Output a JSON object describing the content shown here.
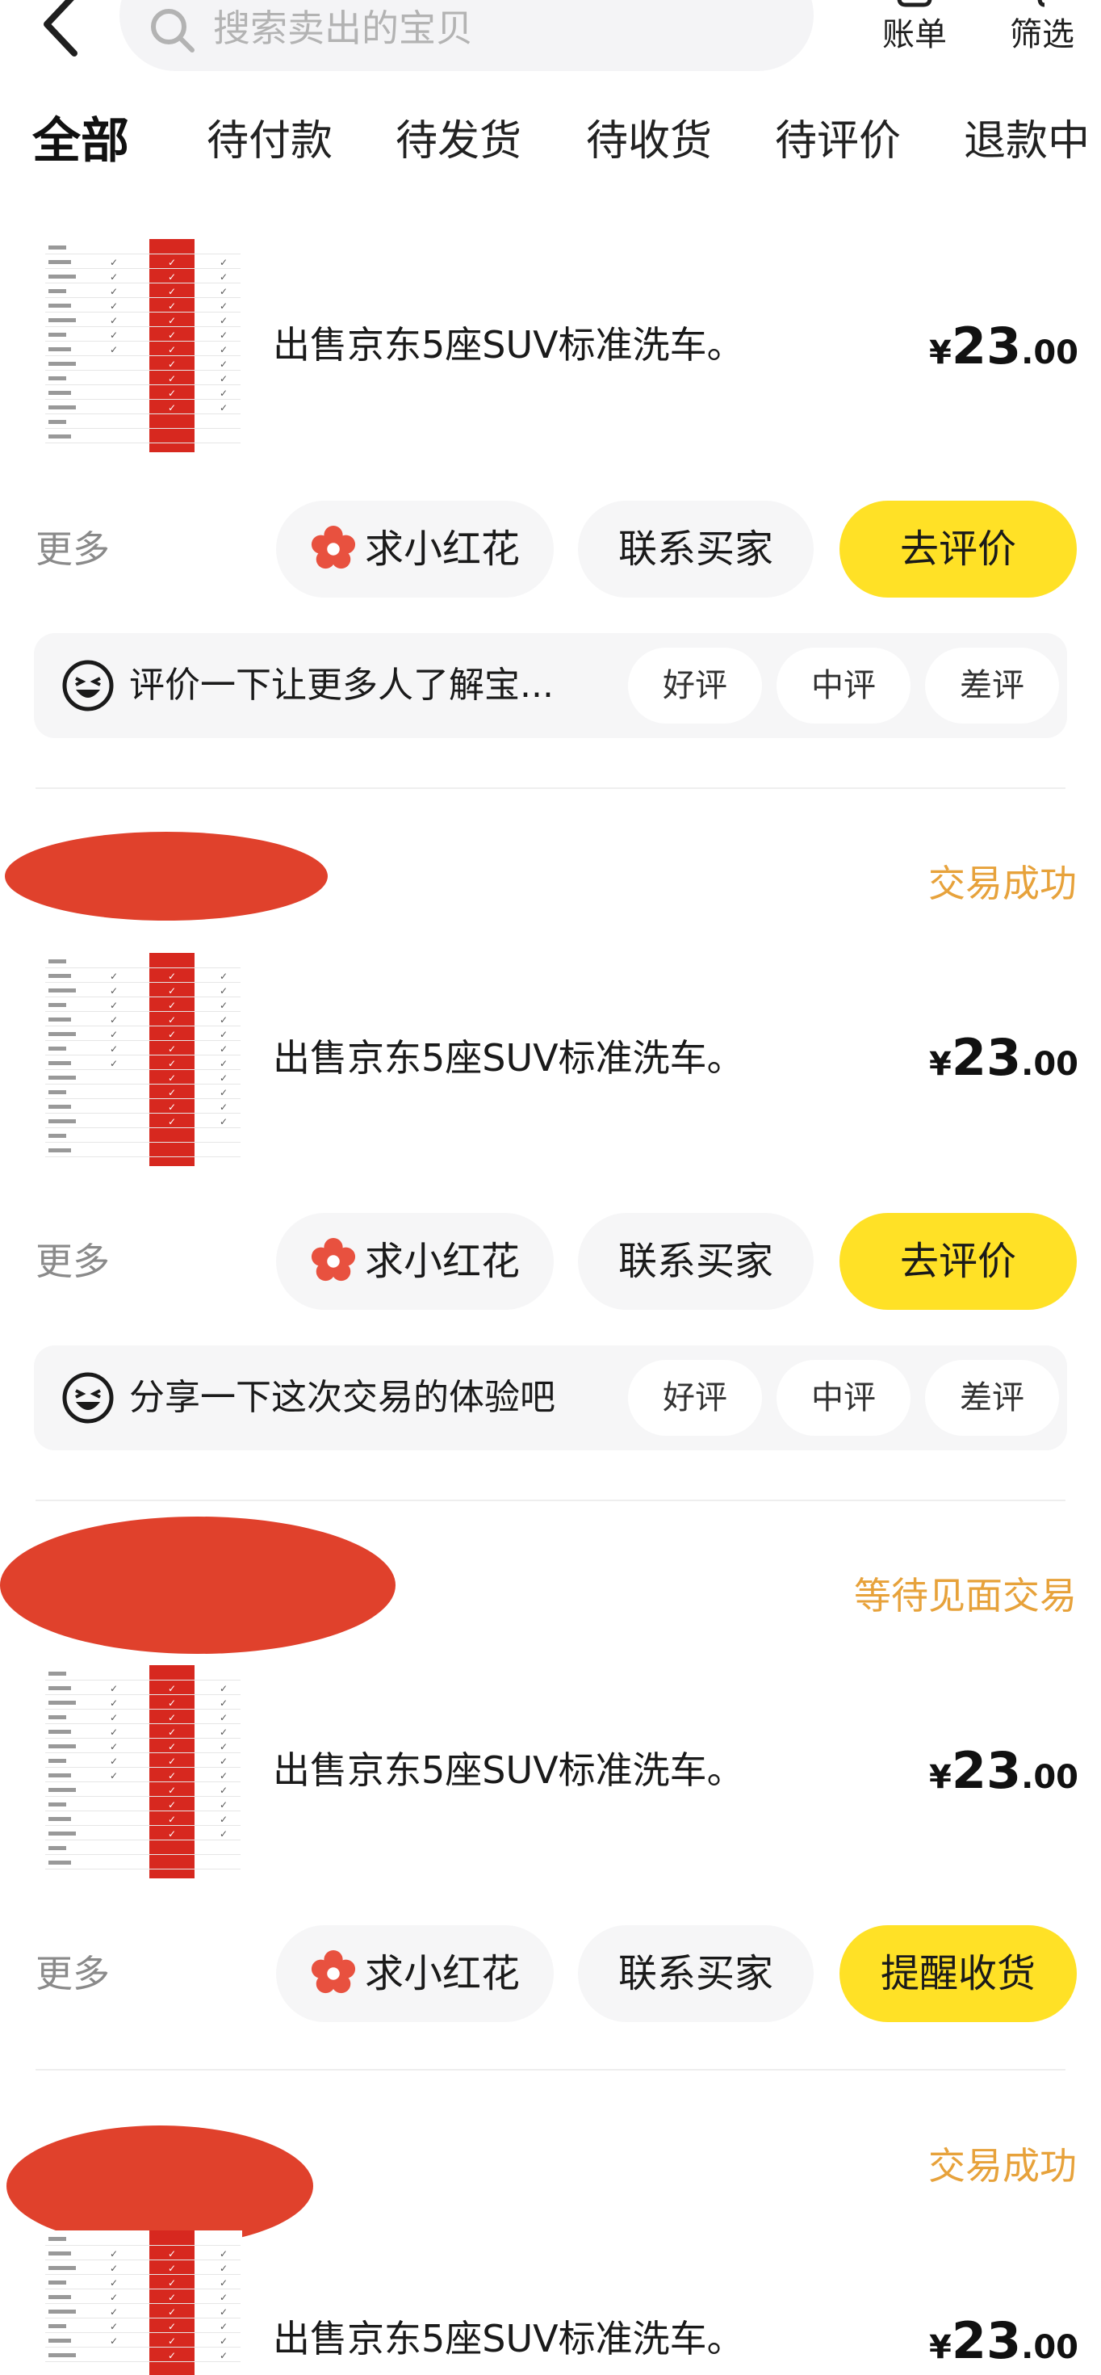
{
  "header": {
    "search_placeholder": "搜索卖出的宝贝",
    "bill_label": "账单",
    "filter_label": "筛选",
    "back_icon": "chevron-left-icon",
    "search_icon": "search-icon"
  },
  "tabs": [
    {
      "label": "全部",
      "active": true
    },
    {
      "label": "待付款"
    },
    {
      "label": "待发货"
    },
    {
      "label": "待收货"
    },
    {
      "label": "待评价"
    },
    {
      "label": "退款中"
    }
  ],
  "orders": [
    {
      "title": "出售京东5座SUV标准洗车。",
      "price_currency": "¥",
      "price_int": "23",
      "price_dec": ".00",
      "status": "",
      "more": "更多",
      "flower_label": "求小红花",
      "contact_label": "联系买家",
      "action_label": "去评价",
      "review_prompt": "评价一下让更多人了解宝...",
      "good": "好评",
      "neutral": "中评",
      "bad": "差评"
    },
    {
      "title": "出售京东5座SUV标准洗车。",
      "price_currency": "¥",
      "price_int": "23",
      "price_dec": ".00",
      "status": "交易成功",
      "more": "更多",
      "flower_label": "求小红花",
      "contact_label": "联系买家",
      "action_label": "去评价",
      "review_prompt": "分享一下这次交易的体验吧",
      "good": "好评",
      "neutral": "中评",
      "bad": "差评"
    },
    {
      "title": "出售京东5座SUV标准洗车。",
      "price_currency": "¥",
      "price_int": "23",
      "price_dec": ".00",
      "status": "等待见面交易",
      "more": "更多",
      "flower_label": "求小红花",
      "contact_label": "联系买家",
      "action_label": "提醒收货"
    },
    {
      "title": "出售京东5座SUV标准洗车。",
      "price_currency": "¥",
      "price_int": "23",
      "price_dec": ".00",
      "status": "交易成功"
    }
  ],
  "colors": {
    "accent_yellow": "#ffe126",
    "status_orange": "#e7a23b",
    "redaction": "#e0412c",
    "pill_bg": "#f6f6f7"
  }
}
